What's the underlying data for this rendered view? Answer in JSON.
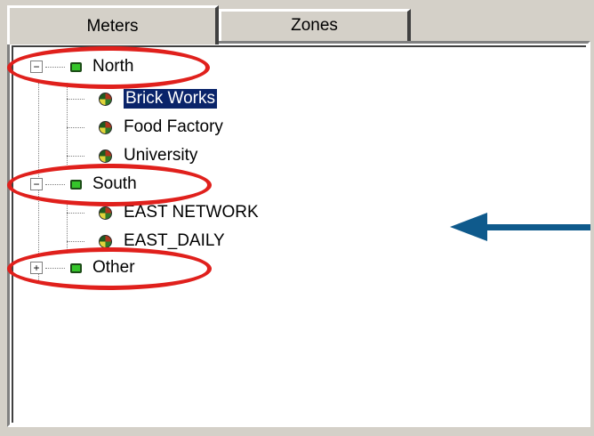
{
  "tabs": [
    {
      "label": "Meters"
    },
    {
      "label": "Zones"
    }
  ],
  "tree": {
    "groups": [
      {
        "label": "North",
        "expander": "−",
        "items": [
          {
            "label": "Brick Works",
            "selected": true
          },
          {
            "label": "Food Factory"
          },
          {
            "label": "University"
          }
        ]
      },
      {
        "label": "South",
        "expander": "−",
        "items": [
          {
            "label": "EAST NETWORK"
          },
          {
            "label": "EAST_DAILY"
          }
        ]
      },
      {
        "label": "Other",
        "expander": "+",
        "items": []
      }
    ]
  },
  "icons": {
    "group": "folder-icon",
    "item": "meter-icon"
  },
  "colors": {
    "highlight": "#e0201c",
    "arrow": "#0f5a8c",
    "selection": "#0a246a",
    "group_icon": "#35c52a"
  }
}
